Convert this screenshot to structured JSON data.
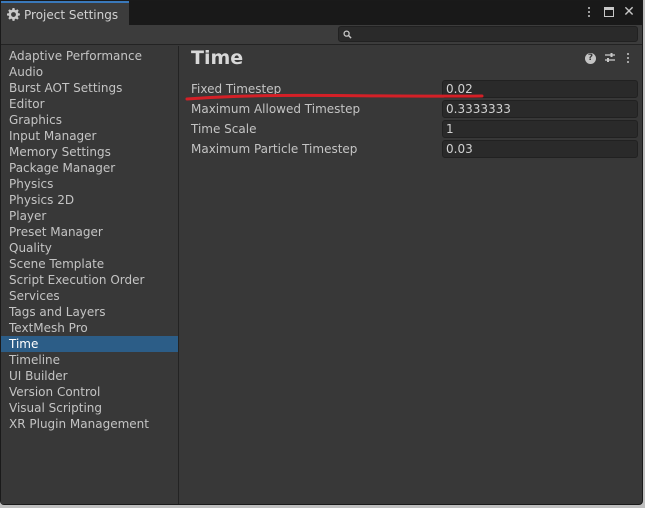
{
  "window": {
    "tab_title": "Project Settings",
    "controls": [
      "kebab-icon",
      "maximize-icon",
      "close-icon"
    ]
  },
  "search": {
    "value": "",
    "icon": "search-icon"
  },
  "sidebar": {
    "items": [
      {
        "label": "Adaptive Performance",
        "selected": false
      },
      {
        "label": "Audio",
        "selected": false
      },
      {
        "label": "Burst AOT Settings",
        "selected": false
      },
      {
        "label": "Editor",
        "selected": false
      },
      {
        "label": "Graphics",
        "selected": false
      },
      {
        "label": "Input Manager",
        "selected": false
      },
      {
        "label": "Memory Settings",
        "selected": false
      },
      {
        "label": "Package Manager",
        "selected": false
      },
      {
        "label": "Physics",
        "selected": false
      },
      {
        "label": "Physics 2D",
        "selected": false
      },
      {
        "label": "Player",
        "selected": false
      },
      {
        "label": "Preset Manager",
        "selected": false
      },
      {
        "label": "Quality",
        "selected": false
      },
      {
        "label": "Scene Template",
        "selected": false
      },
      {
        "label": "Script Execution Order",
        "selected": false
      },
      {
        "label": "Services",
        "selected": false
      },
      {
        "label": "Tags and Layers",
        "selected": false
      },
      {
        "label": "TextMesh Pro",
        "selected": false
      },
      {
        "label": "Time",
        "selected": true
      },
      {
        "label": "Timeline",
        "selected": false
      },
      {
        "label": "UI Builder",
        "selected": false
      },
      {
        "label": "Version Control",
        "selected": false
      },
      {
        "label": "Visual Scripting",
        "selected": false
      },
      {
        "label": "XR Plugin Management",
        "selected": false
      }
    ]
  },
  "main": {
    "title": "Time",
    "header_icons": [
      "help-icon",
      "preset-icon",
      "kebab-icon"
    ],
    "fields": [
      {
        "label": "Fixed Timestep",
        "value": "0.02"
      },
      {
        "label": "Maximum Allowed Timestep",
        "value": "0.3333333"
      },
      {
        "label": "Time Scale",
        "value": "1"
      },
      {
        "label": "Maximum Particle Timestep",
        "value": "0.03"
      }
    ]
  },
  "colors": {
    "background": "#383838",
    "tab_accent": "#3a79bb",
    "selection": "#2c5d87",
    "annotation": "#d42027"
  }
}
